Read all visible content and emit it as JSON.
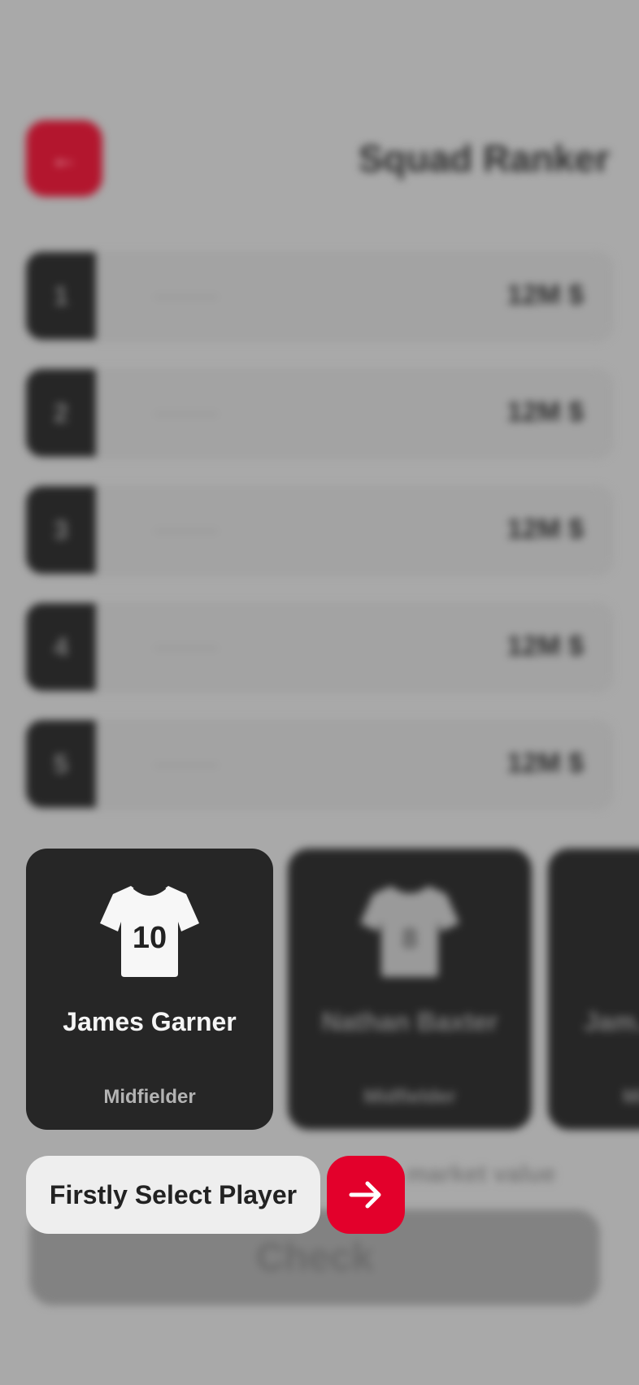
{
  "header": {
    "title": "Squad Ranker",
    "back_label": "←"
  },
  "ranking": {
    "rows": [
      {
        "rank": "1",
        "name": "———",
        "value": "12M $"
      },
      {
        "rank": "2",
        "name": "———",
        "value": "12M $"
      },
      {
        "rank": "3",
        "name": "———",
        "value": "12M $"
      },
      {
        "rank": "4",
        "name": "———",
        "value": "12M $"
      },
      {
        "rank": "5",
        "name": "———",
        "value": "12M $"
      }
    ]
  },
  "players": [
    {
      "number": "10",
      "name": "James Garner",
      "position": "Midfielder"
    },
    {
      "number": "8",
      "name": "Nathan Baxter",
      "position": "Midfielder"
    },
    {
      "number": "",
      "name": "Jam... silv...",
      "position": "Mi..."
    }
  ],
  "footer": {
    "market_text": "market value",
    "check_label": "Check"
  },
  "onboarding": {
    "hint": "Firstly Select Player"
  },
  "colors": {
    "accent": "#e3002b",
    "card": "#262626",
    "overlay": "#a9a9a9"
  }
}
